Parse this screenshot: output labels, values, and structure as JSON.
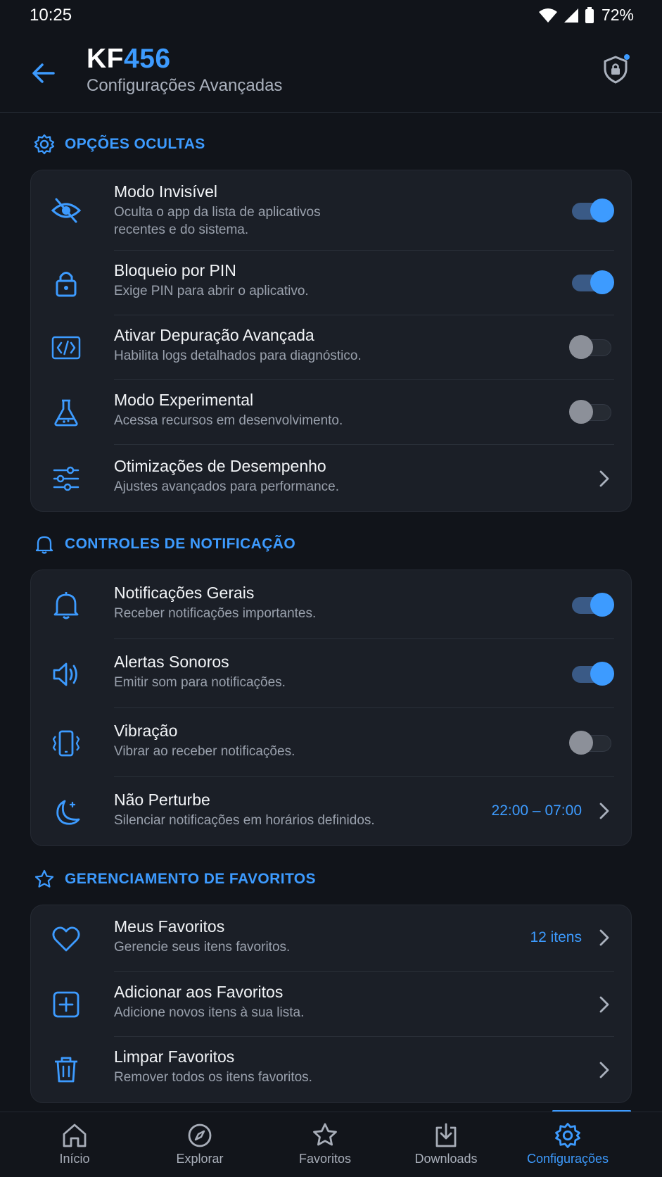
{
  "status_bar": {
    "time": "10:25",
    "battery": "72%"
  },
  "header": {
    "title_prefix": "KF",
    "title_suffix": "456",
    "subtitle": "Configurações Avançadas"
  },
  "colors": {
    "accent": "#3d9bff",
    "background": "#11141a",
    "card": "#1b1f27"
  },
  "sections": {
    "hidden": {
      "title": "OPÇÕES OCULTAS",
      "items": [
        {
          "icon": "eye-off-icon",
          "name": "Modo Invisível",
          "desc_line1": "Oculta o app da lista de aplicativos",
          "desc_line2": "recentes e do sistema.",
          "toggle": true
        },
        {
          "icon": "lock-icon",
          "name": "Bloqueio por PIN",
          "desc": "Exige PIN para abrir o aplicativo.",
          "toggle": true
        },
        {
          "icon": "code-icon",
          "name": "Ativar Depuração Avançada",
          "desc": "Habilita logs detalhados para diagnóstico.",
          "toggle": false
        },
        {
          "icon": "flask-icon",
          "name": "Modo Experimental",
          "desc": "Acessa recursos em desenvolvimento.",
          "toggle": false
        },
        {
          "icon": "sliders-icon",
          "name": "Otimizações de Desempenho",
          "desc": "Ajustes avançados para performance."
        }
      ]
    },
    "notifications": {
      "title": "CONTROLES DE NOTIFICAÇÃO",
      "items": [
        {
          "icon": "bell-icon",
          "name": "Notificações Gerais",
          "desc": "Receber notificações importantes.",
          "toggle": true
        },
        {
          "icon": "speaker-icon",
          "name": "Alertas Sonoros",
          "desc": "Emitir som para notificações.",
          "toggle": true
        },
        {
          "icon": "vibrate-icon",
          "name": "Vibração",
          "desc": "Vibrar ao receber notificações.",
          "toggle": false
        },
        {
          "icon": "moon-icon",
          "name": "Não Perturbe",
          "desc": "Silenciar notificações em horários definidos.",
          "value": "22:00 – 07:00"
        }
      ]
    },
    "favorites": {
      "title": "GERENCIAMENTO DE FAVORITOS",
      "items": [
        {
          "icon": "heart-icon",
          "name": "Meus Favoritos",
          "desc": "Gerencie seus itens favoritos.",
          "value": "12 itens"
        },
        {
          "icon": "plus-square-icon",
          "name": "Adicionar aos Favoritos",
          "desc": "Adicione novos itens à sua lista."
        },
        {
          "icon": "trash-icon",
          "name": "Limpar Favoritos",
          "desc": "Remover todos os itens favoritos."
        }
      ]
    }
  },
  "bottom_nav": [
    {
      "icon": "home-icon",
      "label": "Início"
    },
    {
      "icon": "compass-icon",
      "label": "Explorar"
    },
    {
      "icon": "star-icon",
      "label": "Favoritos"
    },
    {
      "icon": "download-icon",
      "label": "Downloads"
    },
    {
      "icon": "gear-icon",
      "label": "Configurações",
      "active": true
    }
  ]
}
